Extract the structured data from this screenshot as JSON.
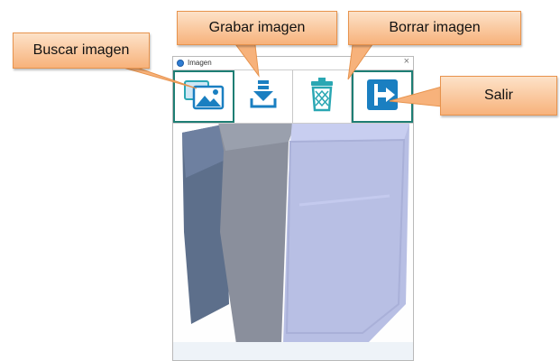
{
  "window": {
    "title": "Imagen",
    "close_glyph": "×",
    "toolbar": [
      {
        "id": "buscar",
        "icon": "image-folder-icon"
      },
      {
        "id": "grabar",
        "icon": "download-save-icon"
      },
      {
        "id": "borrar",
        "icon": "trash-icon"
      },
      {
        "id": "salir",
        "icon": "exit-door-icon"
      }
    ]
  },
  "callouts": {
    "buscar": "Buscar imagen",
    "grabar": "Grabar imagen",
    "borrar": "Borrar imagen",
    "salir": "Salir"
  },
  "colors": {
    "callout_fill": "#f7b27b",
    "callout_border": "#e7934d",
    "toolbar_accent": "#1e7e74",
    "icon_blue": "#1a7fc1",
    "icon_teal": "#2aa7b3"
  }
}
